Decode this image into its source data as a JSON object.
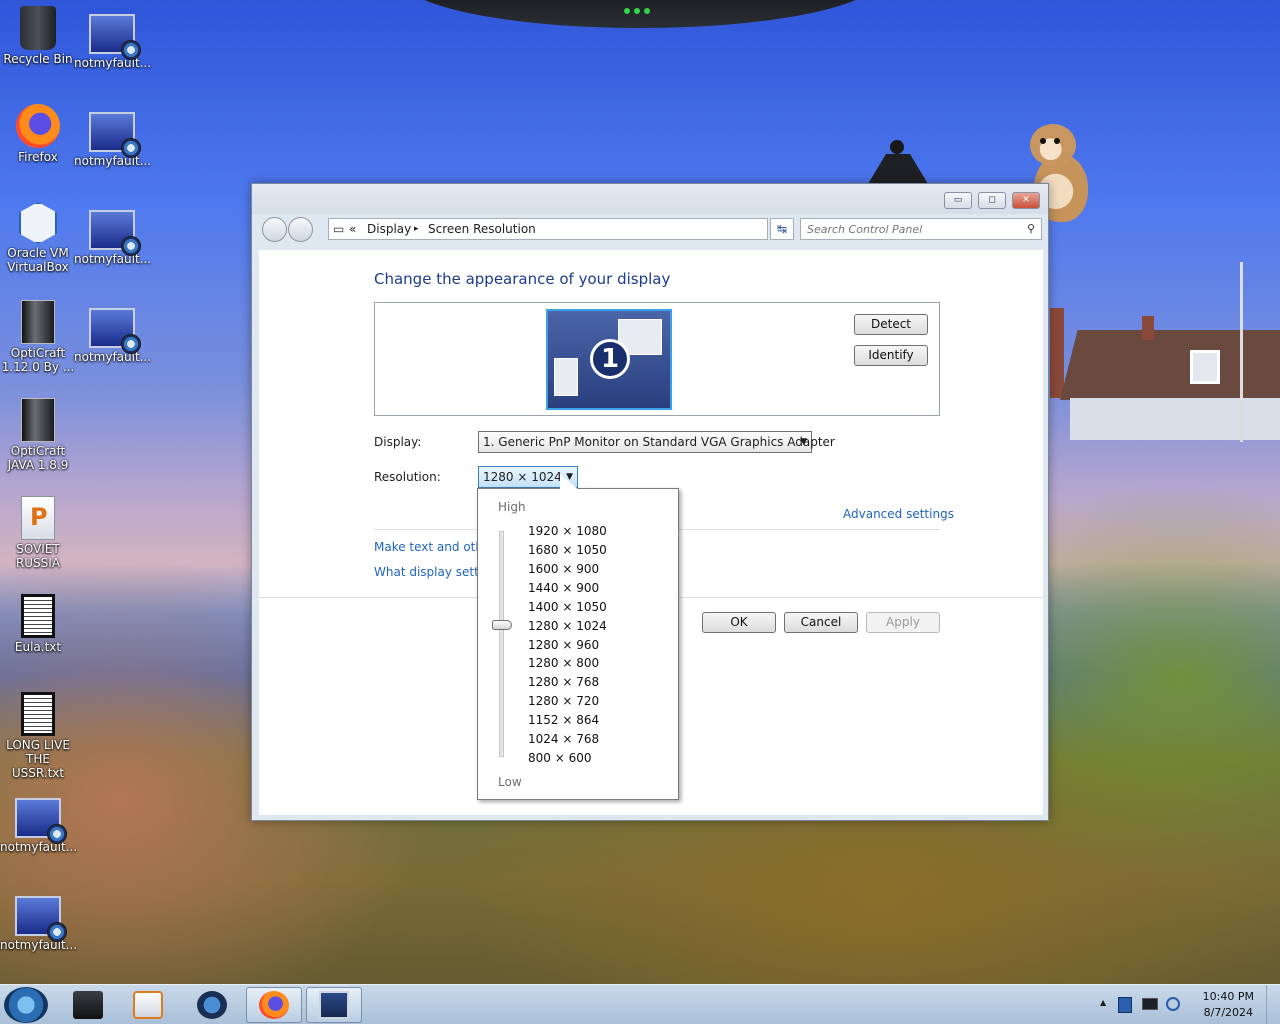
{
  "desktop": {
    "icons": [
      {
        "label": "Recycle Bin",
        "icon": "recycle-bin-icon"
      },
      {
        "label": "notmyfault...",
        "icon": "notmyfault-icon"
      },
      {
        "label": "Firefox",
        "icon": "firefox-icon"
      },
      {
        "label": "notmyfault...",
        "icon": "notmyfault-icon"
      },
      {
        "label": "Oracle VM\nVirtualBox",
        "icon": "virtualbox-icon"
      },
      {
        "label": "notmyfault...",
        "icon": "notmyfault-icon"
      },
      {
        "label": "OptiCraft\n1.12.0 By ...",
        "icon": "opticraft-icon"
      },
      {
        "label": "notmyfault...",
        "icon": "notmyfault-icon"
      },
      {
        "label": "OptiCraft\nJAVA 1.8.9",
        "icon": "opticraft-java-icon"
      },
      {
        "label": "SOVIET\nRUSSIA",
        "icon": "soviet-russia-icon"
      },
      {
        "label": "Eula.txt",
        "icon": "text-file-icon"
      },
      {
        "label": "LONG LIVE\nTHE USSR.txt",
        "icon": "text-file-icon"
      },
      {
        "label": "notmyfault...",
        "icon": "notmyfault-icon"
      },
      {
        "label": "notmyfault...",
        "icon": "notmyfault-icon"
      }
    ]
  },
  "window": {
    "title_buttons": {
      "minimize": "▭",
      "maximize": "◻",
      "close": "✕"
    },
    "address": {
      "overflow": "«",
      "crumbs": [
        "Display",
        "Screen Resolution"
      ],
      "separator": "▸",
      "dropdown_arrow": "▾"
    },
    "refresh_glyph": "↹",
    "search": {
      "placeholder": "Search Control Panel",
      "icon": "⚲"
    },
    "heading": "Change the appearance of your display",
    "monitor_number": "1",
    "detect_label": "Detect",
    "identify_label": "Identify",
    "display_label": "Display:",
    "display_value": "1. Generic PnP Monitor on Standard VGA Graphics Adapter",
    "resolution_label": "Resolution:",
    "resolution_value": "1280 × 1024",
    "advanced_settings": "Advanced settings",
    "link_text_size": "Make text and othe",
    "link_what_display": "What display setting",
    "ok_label": "OK",
    "cancel_label": "Cancel",
    "apply_label": "Apply"
  },
  "resolution_dropdown": {
    "high_label": "High",
    "low_label": "Low",
    "options": [
      "1920 × 1080",
      "1680 × 1050",
      "1600 × 900",
      "1440 × 900",
      "1400 × 1050",
      "1280 × 1024",
      "1280 × 960",
      "1280 × 800",
      "1280 × 768",
      "1280 × 720",
      "1152 × 864",
      "1024 × 768",
      "800 × 600"
    ],
    "selected": "1280 × 1024"
  },
  "taskbar": {
    "items": [
      "start-orb",
      "folder",
      "media-player",
      "globe",
      "firefox",
      "control-panel"
    ],
    "tray_arrow": "▲",
    "time": "10:40 PM",
    "date": "8/7/2024"
  }
}
